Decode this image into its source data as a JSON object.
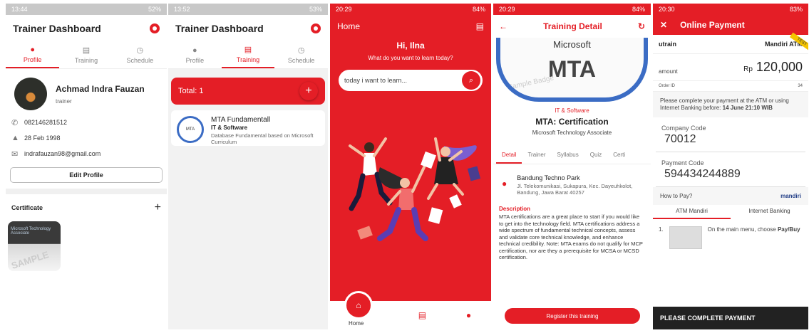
{
  "screens": {
    "s1": {
      "status": {
        "time": "13:44",
        "battery": "52%"
      },
      "title": "Trainer Dashboard",
      "tabs": [
        {
          "label": "Profile"
        },
        {
          "label": "Training"
        },
        {
          "label": "Schedule"
        }
      ],
      "user": {
        "name": "Achmad Indra Fauzan",
        "role": "trainer",
        "phone": "082146281512",
        "birth": "28 Feb 1998",
        "email": "indrafauzan98@gmail.com"
      },
      "edit_label": "Edit Profile",
      "cert_label": "Certificate",
      "cert_thumb_text": "Microsoft Technology Associate",
      "cert_watermark": "SAMPLE"
    },
    "s2": {
      "status": {
        "time": "13:52",
        "battery": "53%"
      },
      "title": "Trainer Dashboard",
      "tabs": [
        {
          "label": "Profile"
        },
        {
          "label": "Training"
        },
        {
          "label": "Schedule"
        }
      ],
      "total": "Total: 1",
      "course": {
        "title": "MTA Fundamentall",
        "category": "IT & Software",
        "desc": "Database Fundamental based on Microsoft Curriculum",
        "logo": "MTA"
      }
    },
    "s3": {
      "status": {
        "time": "20:29",
        "battery": "84%"
      },
      "title": "Home",
      "greeting": "Hi, Ilna",
      "sub": "What do you want to learn today?",
      "search_placeholder": "today i want to learn...",
      "nav_home": "Home"
    },
    "s4": {
      "status": {
        "time": "20:29",
        "battery": "84%"
      },
      "title": "Training Detail",
      "badge_brand": "Microsoft",
      "badge_text": "MTA",
      "badge_watermark": "Sample Badge",
      "category": "IT & Software",
      "course_title": "MTA: Certification",
      "course_sub": "Microsoft Technology Associate",
      "tabs": [
        "Detail",
        "Trainer",
        "Syllabus",
        "Quiz",
        "Certi"
      ],
      "location": {
        "name": "Bandung Techno Park",
        "address": "Jl. Telekomunikasi, Sukapura, Kec. Dayeuhkolot, Bandung, Jawa Barat 40257"
      },
      "desc_head": "Description",
      "desc": "MTA certifications are a great place to start if you would like to get into the technology field. MTA certifications address a wide spectrum of fundamental technical concepts, assess and validate core technical knowledge, and enhance technical credibility. Note: MTA exams do not qualify for MCP certification, nor are they a prerequisite for MCSA or MCSD certification.",
      "register": "Register this training"
    },
    "s5": {
      "status": {
        "time": "20:30",
        "battery": "83%"
      },
      "title": "Online Payment",
      "merchant": "utrain",
      "bank": "Mandiri ATM",
      "test_label": "TEST",
      "amount_label": "amount",
      "amount_cur": "Rp",
      "amount": "120,000",
      "order_label": "Order ID",
      "order_id": "34",
      "notice": "Please complete your payment at the ATM or using Internet Banking before:",
      "deadline": "14 June 21:10 WIB",
      "company_label": "Company Code",
      "company_code": "70012",
      "payment_label": "Payment Code",
      "payment_code": "594434244889",
      "howto": "How to Pay?",
      "howto_brand": "mandiri",
      "ptabs": [
        "ATM Mandiri",
        "Internet Banking"
      ],
      "step_num": "1.",
      "step_text": "On the main menu, choose",
      "step_strong": "Pay/Buy",
      "complete": "PLEASE COMPLETE PAYMENT"
    }
  },
  "colors": {
    "brand": "#e41e26",
    "blue": "#3b6cc4"
  }
}
